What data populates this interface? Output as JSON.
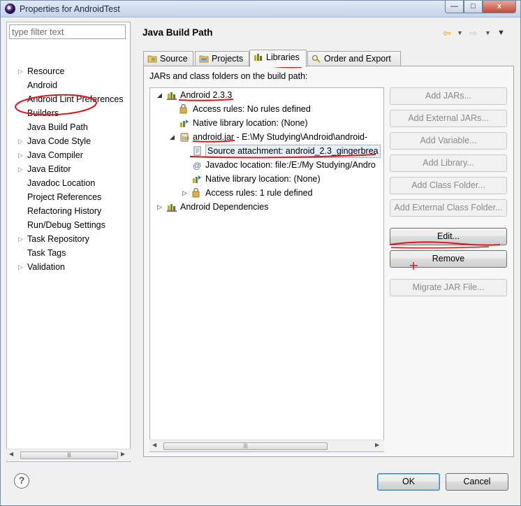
{
  "window": {
    "title": "Properties for AndroidTest",
    "close_glyph": "x",
    "min_glyph": "—",
    "max_glyph": "□"
  },
  "filter": {
    "placeholder": "type filter text",
    "value": ""
  },
  "nav": [
    {
      "label": "Resource",
      "expandable": true
    },
    {
      "label": "Android",
      "expandable": false
    },
    {
      "label": "Android Lint Preferences",
      "expandable": false
    },
    {
      "label": "Builders",
      "expandable": false
    },
    {
      "label": "Java Build Path",
      "expandable": false,
      "selected": true
    },
    {
      "label": "Java Code Style",
      "expandable": true
    },
    {
      "label": "Java Compiler",
      "expandable": true
    },
    {
      "label": "Java Editor",
      "expandable": true
    },
    {
      "label": "Javadoc Location",
      "expandable": false
    },
    {
      "label": "Project References",
      "expandable": false
    },
    {
      "label": "Refactoring History",
      "expandable": false
    },
    {
      "label": "Run/Debug Settings",
      "expandable": false
    },
    {
      "label": "Task Repository",
      "expandable": true
    },
    {
      "label": "Task Tags",
      "expandable": false
    },
    {
      "label": "Validation",
      "expandable": true
    }
  ],
  "page": {
    "title": "Java Build Path"
  },
  "tabs": [
    {
      "label": "Source",
      "icon": "source-folder-icon",
      "active": false
    },
    {
      "label": "Projects",
      "icon": "projects-icon",
      "active": false
    },
    {
      "label": "Libraries",
      "icon": "libraries-icon",
      "active": true
    },
    {
      "label": "Order and Export",
      "icon": "order-export-icon",
      "active": false
    }
  ],
  "libraries": {
    "section_label": "JARs and class folders on the build path:",
    "tree": [
      {
        "label": "Android 2.3.3",
        "icon": "library-icon",
        "exp": "▲"
      },
      {
        "label": "Access rules: No rules defined",
        "icon": "access-rules-icon",
        "exp": ""
      },
      {
        "label": "Native library location: (None)",
        "icon": "native-library-icon",
        "exp": ""
      },
      {
        "label": "android.jar - E:\\My Studying\\Android\\android-",
        "icon": "jar-icon",
        "exp": "▲"
      },
      {
        "label": "Source attachment: android_2.3_gingerbrea",
        "icon": "source-attachment-icon",
        "exp": "",
        "selected": true
      },
      {
        "label": "Javadoc location: file:/E:/My Studying/Andro",
        "icon": "javadoc-icon",
        "exp": ""
      },
      {
        "label": "Native library location: (None)",
        "icon": "native-library-icon",
        "exp": ""
      },
      {
        "label": "Access rules: 1 rule defined",
        "icon": "access-rules-icon",
        "exp": "▷"
      },
      {
        "label": "Android Dependencies",
        "icon": "library-icon",
        "exp": "▷"
      }
    ],
    "buttons": [
      {
        "label": "Add JARs...",
        "enabled": false
      },
      {
        "label": "Add External JARs...",
        "enabled": false
      },
      {
        "label": "Add Variable...",
        "enabled": false
      },
      {
        "label": "Add Library...",
        "enabled": false
      },
      {
        "label": "Add Class Folder...",
        "enabled": false
      },
      {
        "label": "Add External Class Folder...",
        "enabled": false
      },
      {
        "label": "Edit...",
        "enabled": true
      },
      {
        "label": "Remove",
        "enabled": true
      },
      {
        "label": "Migrate JAR File...",
        "enabled": false
      }
    ]
  },
  "scroll_glyphs": {
    "left": "◀",
    "right": "▶",
    "grip": "|||"
  },
  "footer": {
    "help": "?",
    "ok": "OK",
    "cancel": "Cancel"
  },
  "colors": {
    "annotation": "#e0161b",
    "selection_border": "#3d7dc8",
    "window_frame": "#7a8ea8"
  }
}
